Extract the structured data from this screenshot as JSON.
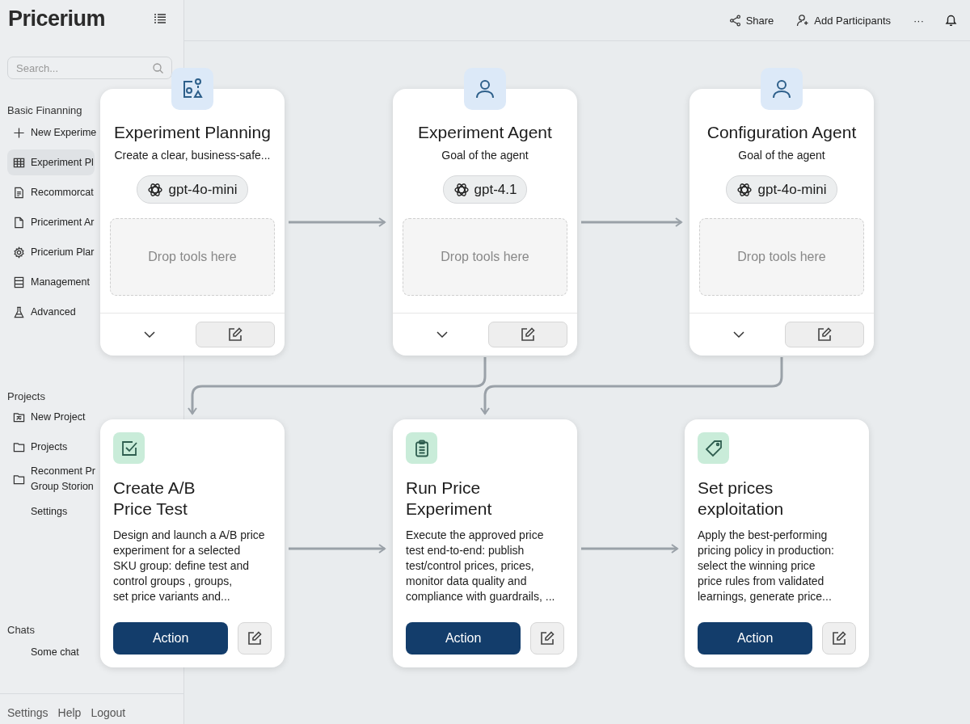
{
  "brand": "Pricerium",
  "search": {
    "placeholder": "Search..."
  },
  "sidebar": {
    "sections": [
      {
        "title": "Basic Finanning",
        "items": [
          {
            "label": "New Experime",
            "selected": false
          },
          {
            "label": "Experiment Pl",
            "selected": true
          },
          {
            "label": "Recommorcat",
            "selected": false
          },
          {
            "label": "Priceriment Ar",
            "selected": false
          },
          {
            "label": "Pricerium Plar",
            "selected": false
          },
          {
            "label": "Management",
            "selected": false
          },
          {
            "label": "Advanced",
            "selected": false
          }
        ]
      },
      {
        "title": "Projects",
        "items": [
          {
            "label": "New Project",
            "selected": false
          },
          {
            "label": "Projects",
            "selected": false
          },
          {
            "label": "Reconment Pr\nGroup Storion",
            "selected": false
          },
          {
            "label": "Settings",
            "selected": false
          }
        ]
      },
      {
        "title": "Chats",
        "items": [
          {
            "label": "Some chat",
            "selected": false
          }
        ]
      }
    ],
    "footer": [
      "Settings",
      "Help",
      "Logout"
    ]
  },
  "topbar": {
    "actions": [
      "Share",
      "Add Participants",
      "···"
    ]
  },
  "agents": [
    {
      "title": "Experiment Planning",
      "subtitle": "Create a clear, business-safe...",
      "model": "gpt-4o-mini",
      "drop": "Drop tools here"
    },
    {
      "title": "Experiment Agent",
      "subtitle": "Goal of the agent",
      "model": "gpt-4.1",
      "drop": "Drop tools here"
    },
    {
      "title": "Configuration Agent",
      "subtitle": "Goal of the agent",
      "model": "gpt-4o-mini",
      "drop": "Drop tools here"
    }
  ],
  "steps": [
    {
      "title": "Create A/B\nPrice Test",
      "description": "Design and launch a A/B price\nexperiment for a selected\nSKU group: define test and\ncontrol groups , groups,\nset price variants and...",
      "action": "Action"
    },
    {
      "title": "Run Price\nExperiment",
      "description": "Execute the approved price\ntest end-to-end: publish\ntest/control prices, prices,\nmonitor data quality and\ncompliance with guardrails, ...",
      "action": "Action"
    },
    {
      "title": "Set prices\nexploitation",
      "description": "Apply the best-performing\npricing policy in production:\nselect the winning price\nprice rules from validated\nlearnings, generate price...",
      "action": "Action"
    }
  ]
}
